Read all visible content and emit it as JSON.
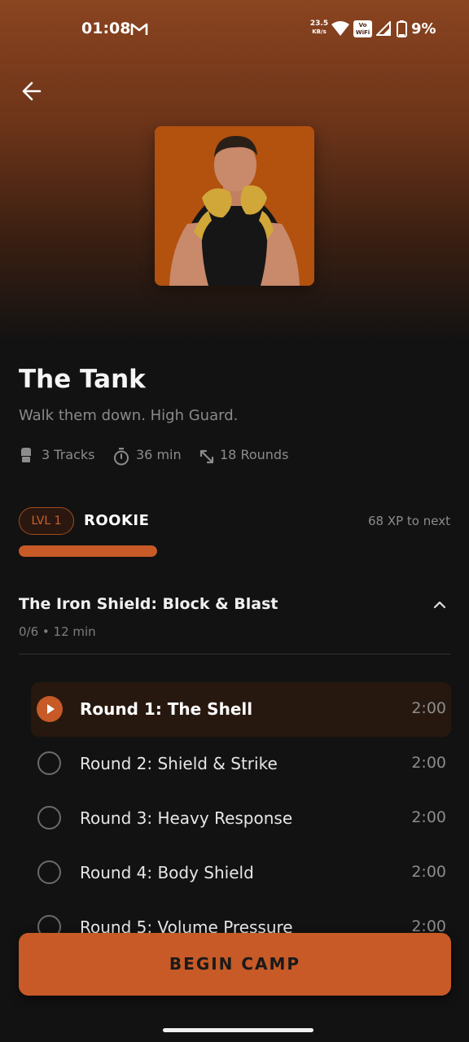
{
  "status_bar": {
    "time": "01:08",
    "net_speed_value": "23.5",
    "net_speed_unit": "KB/s",
    "vowifi_line1": "Vo",
    "vowifi_line2": "WiFi",
    "battery": "9%"
  },
  "camp": {
    "title": "The Tank",
    "subtitle": "Walk them down. High Guard.",
    "stats": {
      "tracks": "3 Tracks",
      "duration": "36 min",
      "rounds": "18 Rounds"
    }
  },
  "level": {
    "badge": "LVL 1",
    "rank": "ROOKIE",
    "xp_to_next": "68 XP to next",
    "progress": 1.0
  },
  "section": {
    "title": "The Iron Shield: Block & Blast",
    "meta": "0/6 • 12 min"
  },
  "rounds": [
    {
      "label": "Round 1: The Shell",
      "duration": "2:00",
      "active": true
    },
    {
      "label": "Round 2: Shield & Strike",
      "duration": "2:00",
      "active": false
    },
    {
      "label": "Round 3: Heavy Response",
      "duration": "2:00",
      "active": false
    },
    {
      "label": "Round 4: Body Shield",
      "duration": "2:00",
      "active": false
    },
    {
      "label": "Round 5: Volume Pressure",
      "duration": "2:00",
      "active": false
    }
  ],
  "cta": {
    "label": "BEGIN CAMP"
  },
  "colors": {
    "accent": "#c75a27",
    "background": "#121212",
    "hero": "#8a4420"
  }
}
